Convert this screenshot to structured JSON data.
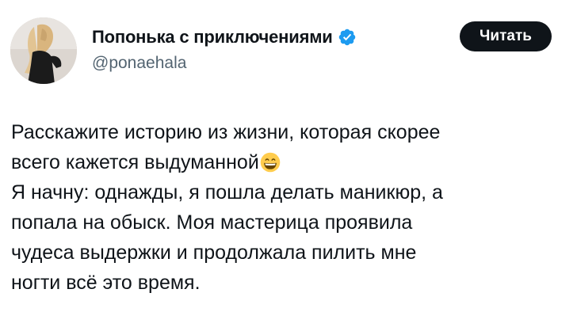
{
  "author": {
    "display_name": "Попонька с приключениями",
    "handle": "@ponaehala",
    "verified": true,
    "avatar_icon": "profile-photo"
  },
  "follow_button": {
    "label": "Читать"
  },
  "tweet": {
    "lines": [
      "Расскажите историю из жизни, которая скорее",
      "всего кажется выдуманной",
      "Я начну: однажды, я пошла делать маникюр, а",
      "попала на обыск. Моя мастерица проявила",
      "чудеса выдержки и продолжала пилить мне",
      "ногти всё это время."
    ],
    "emoji": "grinning-face-with-smiling-eyes"
  },
  "colors": {
    "text": "#0f1419",
    "secondary": "#536471",
    "verified": "#1d9bf0",
    "button_bg": "#0f1419",
    "button_text": "#ffffff"
  }
}
